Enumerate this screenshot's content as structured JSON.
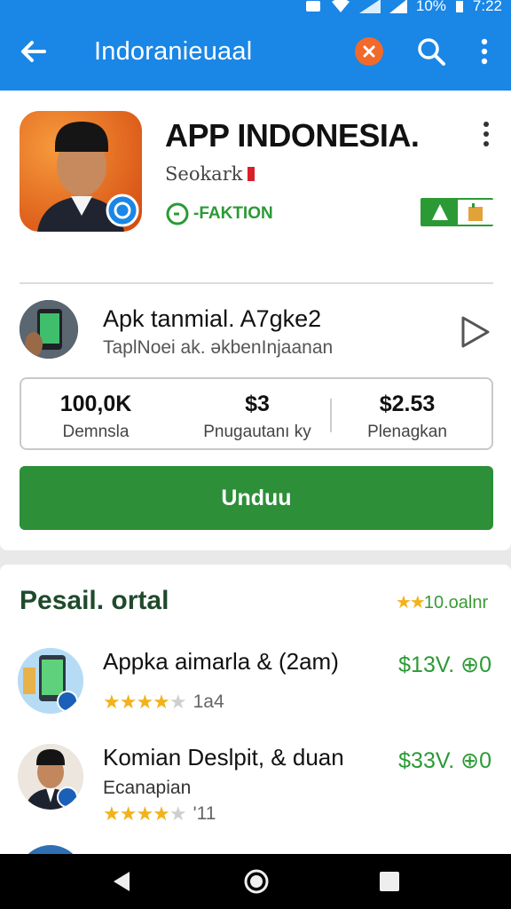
{
  "status_bar": {
    "battery": "10%",
    "time": "7:22"
  },
  "app_bar": {
    "title": "Indoranieuaal",
    "back_icon": "arrow-left-icon",
    "clear_icon": "close-circle-icon",
    "search_icon": "search-icon",
    "menu_icon": "more-vert-icon"
  },
  "app": {
    "name": "APP INDONESIA.",
    "developer": "Seokark",
    "badge_label": "-FAKTION",
    "icon_name": "app-portrait-icon"
  },
  "promo": {
    "title": "Apk tanmial.  A7gke2",
    "subtitle": "TaplNoei ak. əkbenInjaanan"
  },
  "stats": [
    {
      "value": "100,0K",
      "label": "Demnsla"
    },
    {
      "value": "$3",
      "label": "Pnugautanı ky"
    },
    {
      "value": "$2.53",
      "label": "Plenagkan"
    }
  ],
  "install_label": "Unduu",
  "section": {
    "title": "Pesail. ortal",
    "side_stars": "★★",
    "side_text": "10.oalnr"
  },
  "list": [
    {
      "title": "Appka aimarla & (2am)",
      "subtitle": "",
      "rating": 4,
      "rating_text": "1a4",
      "price": "$13V. ⊕0"
    },
    {
      "title": "Komian Deslpit, & duan",
      "subtitle": "Ecanapian",
      "rating": 4,
      "rating_text": "'11",
      "price": "$33V. ⊕0"
    }
  ],
  "colors": {
    "primary": "#1a86e6",
    "accent_green": "#2d8f38",
    "orange": "#f16a2b",
    "star": "#f2b21b"
  }
}
